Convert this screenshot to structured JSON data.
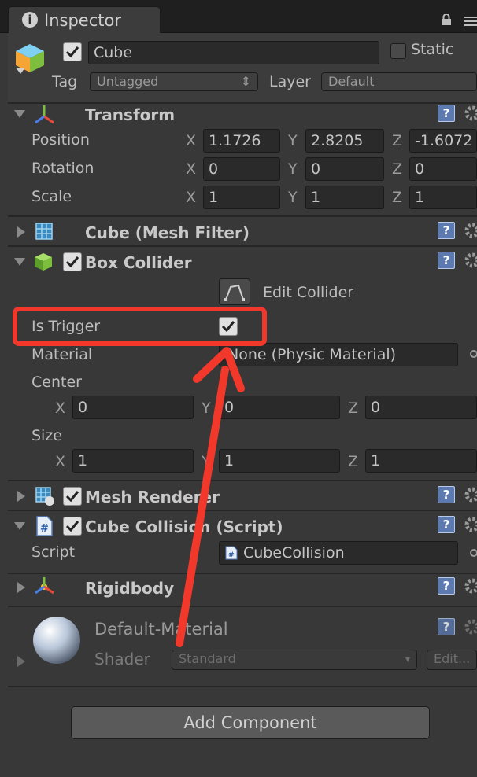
{
  "tab": {
    "title": "Inspector",
    "icon": "info-icon"
  },
  "object": {
    "name": "Cube",
    "static_label": "Static",
    "tag_label": "Tag",
    "tag_value": "Untagged",
    "layer_label": "Layer",
    "layer_value": "Default"
  },
  "transform": {
    "title": "Transform",
    "position_label": "Position",
    "rotation_label": "Rotation",
    "scale_label": "Scale",
    "x": "X",
    "y": "Y",
    "z": "Z",
    "position": [
      "1.1726",
      "2.8205",
      "-1.6072"
    ],
    "rotation": [
      "0",
      "0",
      "0"
    ],
    "scale": [
      "1",
      "1",
      "1"
    ]
  },
  "mesh_filter": {
    "title": "Cube (Mesh Filter)"
  },
  "box_collider": {
    "title": "Box Collider",
    "edit_label": "Edit Collider",
    "is_trigger_label": "Is Trigger",
    "material_label": "Material",
    "material_value": "None (Physic Material)",
    "center_label": "Center",
    "center": [
      "0",
      "0",
      "0"
    ],
    "size_label": "Size",
    "size": [
      "1",
      "1",
      "1"
    ]
  },
  "mesh_renderer": {
    "title": "Mesh Renderer"
  },
  "script_comp": {
    "title": "Cube Collision (Script)",
    "script_label": "Script",
    "script_value": "CubeCollision"
  },
  "rigidbody": {
    "title": "Rigidbody"
  },
  "material": {
    "name": "Default-Material",
    "shader_label": "Shader",
    "shader_value": "Standard",
    "edit_label": "Edit..."
  },
  "add_component": "Add Component",
  "colors": {
    "highlight": "#f2382b",
    "help_icon": "#5c7ab0"
  }
}
